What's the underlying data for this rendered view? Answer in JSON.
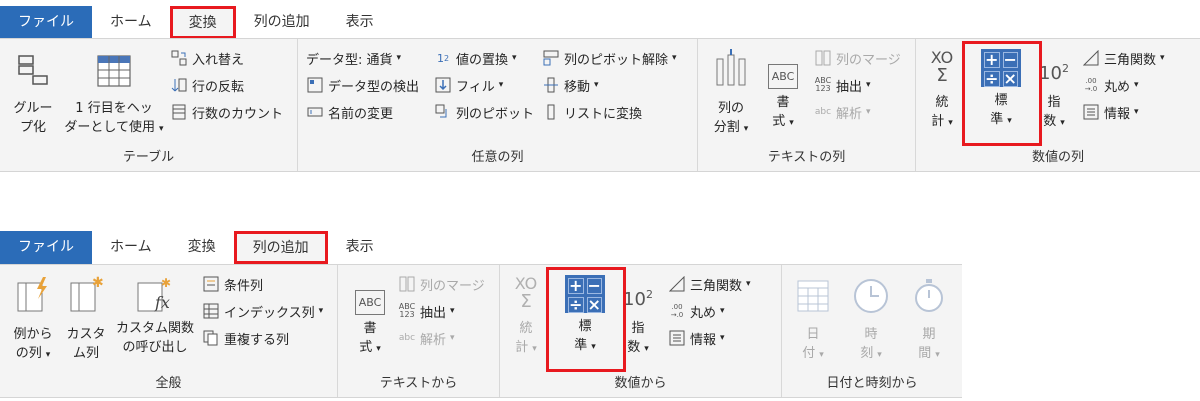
{
  "ribbon1": {
    "tabs": [
      "ファイル",
      "ホーム",
      "変換",
      "列の追加",
      "表示"
    ],
    "groups": {
      "table": {
        "label": "テーブル",
        "group_btn": [
          "グルー",
          "プ化"
        ],
        "header_btn": [
          "1 行目をヘッ",
          "ダーとして使用"
        ],
        "swap": "入れ替え",
        "reverse": "行の反転",
        "count": "行数のカウント"
      },
      "any_column": {
        "label": "任意の列",
        "datatype": "データ型: 通貨",
        "detect": "データ型の検出",
        "rename": "名前の変更",
        "replace": "値の置換",
        "fill": "フィル",
        "pivot": "列のピボット",
        "unpivot": "列のピボット解除",
        "move": "移動",
        "tolist": "リストに変換"
      },
      "text_column": {
        "label": "テキストの列",
        "split": [
          "列の",
          "分割"
        ],
        "format": [
          "書",
          "式"
        ],
        "merge": "列のマージ",
        "extract": "抽出",
        "parse": "解析"
      },
      "number_column": {
        "label": "数値の列",
        "stats": [
          "統",
          "計"
        ],
        "standard": [
          "標",
          "準"
        ],
        "scientific": [
          "指",
          "数"
        ],
        "trig": "三角関数",
        "round": "丸め",
        "info": "情報"
      }
    }
  },
  "ribbon2": {
    "tabs": [
      "ファイル",
      "ホーム",
      "変換",
      "列の追加",
      "表示"
    ],
    "groups": {
      "general": {
        "label": "全般",
        "from_examples": [
          "例から",
          "の列"
        ],
        "custom": [
          "カスタ",
          "ム列"
        ],
        "invoke": [
          "カスタム関数",
          "の呼び出し"
        ],
        "conditional": "条件列",
        "index": "インデックス列",
        "duplicate": "重複する列"
      },
      "from_text": {
        "label": "テキストから",
        "format": [
          "書",
          "式"
        ],
        "merge": "列のマージ",
        "extract": "抽出",
        "parse": "解析"
      },
      "from_number": {
        "label": "数値から",
        "stats": [
          "統",
          "計"
        ],
        "standard": [
          "標",
          "準"
        ],
        "scientific": [
          "指",
          "数"
        ],
        "trig": "三角関数",
        "round": "丸め",
        "info": "情報"
      },
      "from_datetime": {
        "label": "日付と時刻から",
        "date": [
          "日",
          "付"
        ],
        "time": [
          "時",
          "刻"
        ],
        "duration": [
          "期",
          "間"
        ]
      }
    }
  },
  "icons": {
    "abc": "ABC",
    "abc123": [
      "ABC",
      "123"
    ],
    "abc_small": "abc",
    "power": "10",
    "power_exp": "2",
    "round_top": ".00",
    "round_bottom": "→.0",
    "stats_top": "XO",
    "stats_sigma": "Σ",
    "onetwo": "1",
    "onetwo_sub": "2",
    "fx": "fx"
  },
  "colors": {
    "file_tab": "#2b6cb8",
    "highlight": "#e8191f",
    "calc_blue": "#3b6fb6"
  }
}
